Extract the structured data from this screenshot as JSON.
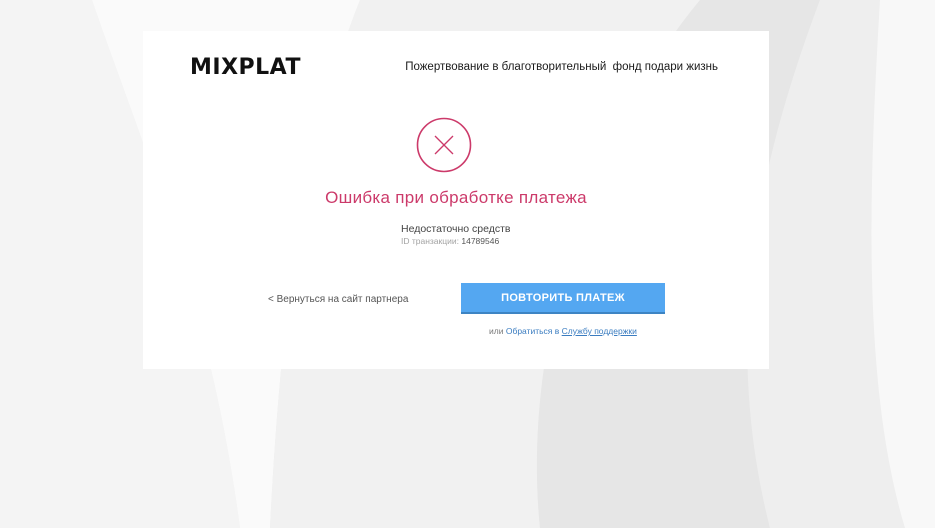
{
  "header": {
    "logo_text": "MIXPLAT",
    "description": "Пожертвование в благотворительный  фонд подари жизнь"
  },
  "status": {
    "icon": "close-icon",
    "title": "Ошибка при обработке платежа",
    "reason": "Недостаточно средств",
    "transaction_label": "ID транзакции:",
    "transaction_id": "14789546"
  },
  "actions": {
    "back_link": "< Вернуться на сайт партнера",
    "retry_button": "ПОВТОРИТЬ ПЛАТЕЖ",
    "support_prefix": "или",
    "support_text": "Обратиться в",
    "support_link": "Службу поддержки"
  },
  "colors": {
    "error": "#cc3a6a",
    "button": "#54a7f1",
    "link": "#3a7cc0"
  }
}
